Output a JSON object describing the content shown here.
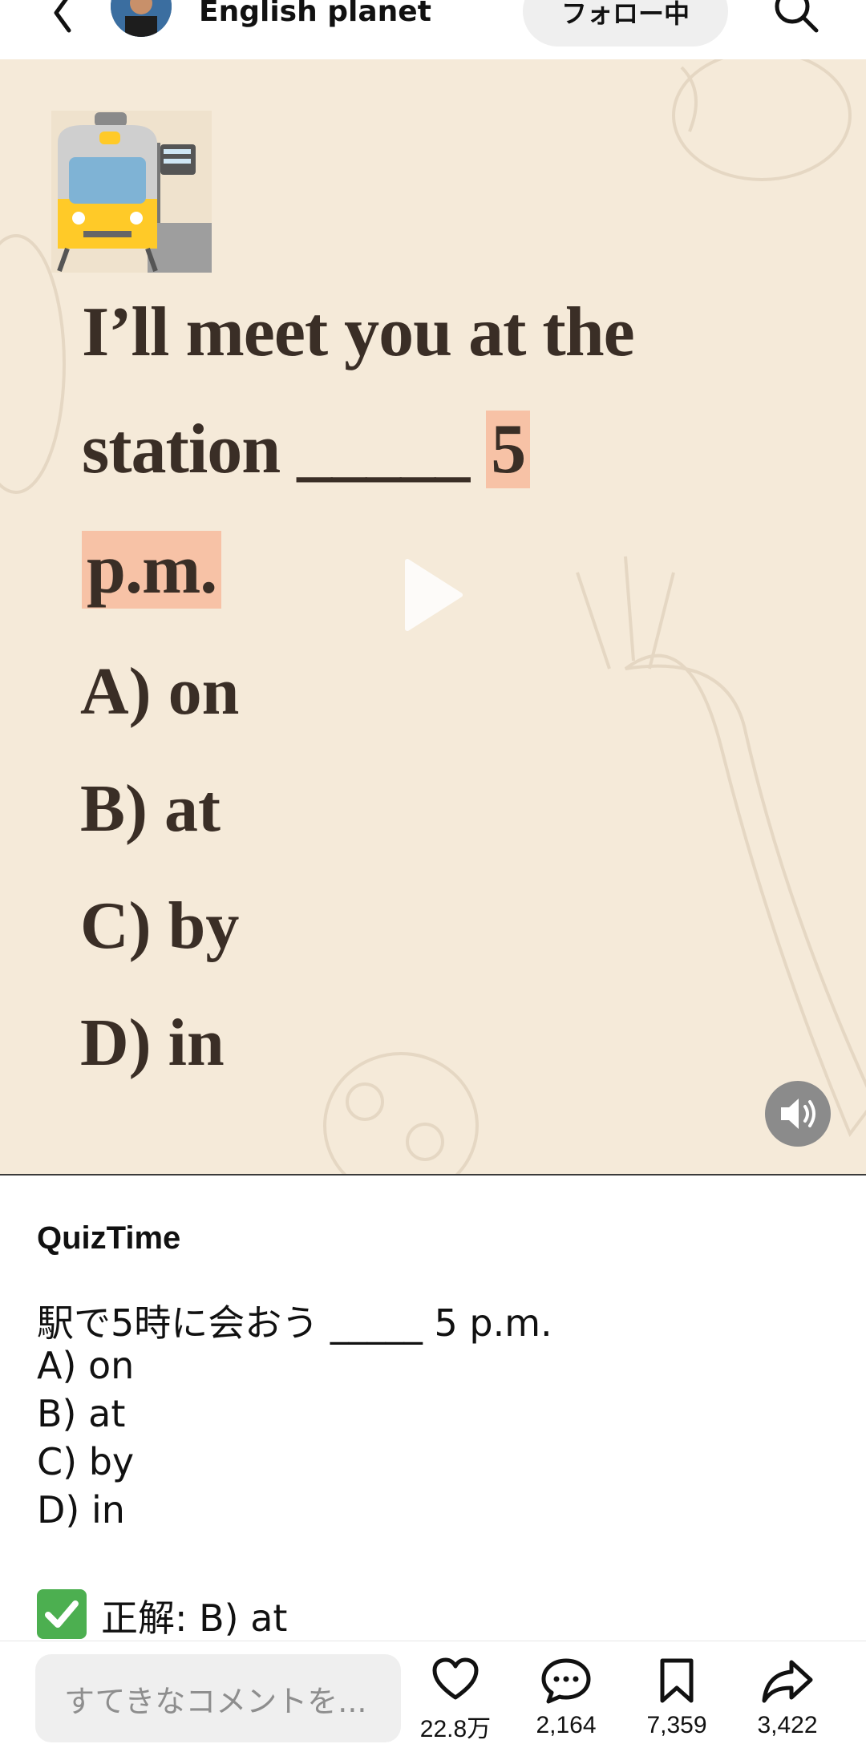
{
  "header": {
    "author": "English planet",
    "follow_label": "フォロー中",
    "icons": [
      "back-icon",
      "avatar",
      "search-icon"
    ]
  },
  "video": {
    "question_line1": "I’ll meet you at the",
    "question_line2_prefix": "station _____",
    "question_highlight_1": "5",
    "question_line3_highlight": "p.m.",
    "options": [
      "A) on",
      "B) at",
      "C) by",
      "D) in"
    ],
    "icons": [
      "train-emoji-icon",
      "play-icon",
      "speaker-icon"
    ],
    "colors": {
      "background": "#f5ead9",
      "highlight": "#f7c2a6",
      "text": "#3a2e26"
    }
  },
  "caption": {
    "author": "QuizTime",
    "question": "駅で5時に会おう _____ 5 p.m.",
    "options": [
      "A) on",
      "B) at",
      "C) by",
      "D) in"
    ],
    "answer": "正解: B) at",
    "icons": [
      "check-mark-icon"
    ]
  },
  "bottom_bar": {
    "comment_placeholder": "すてきなコメントを...",
    "likes": "22.8万",
    "comments": "2,164",
    "saves": "7,359",
    "shares": "3,422",
    "icons": [
      "heart-icon",
      "comment-icon",
      "bookmark-icon",
      "share-icon"
    ]
  }
}
